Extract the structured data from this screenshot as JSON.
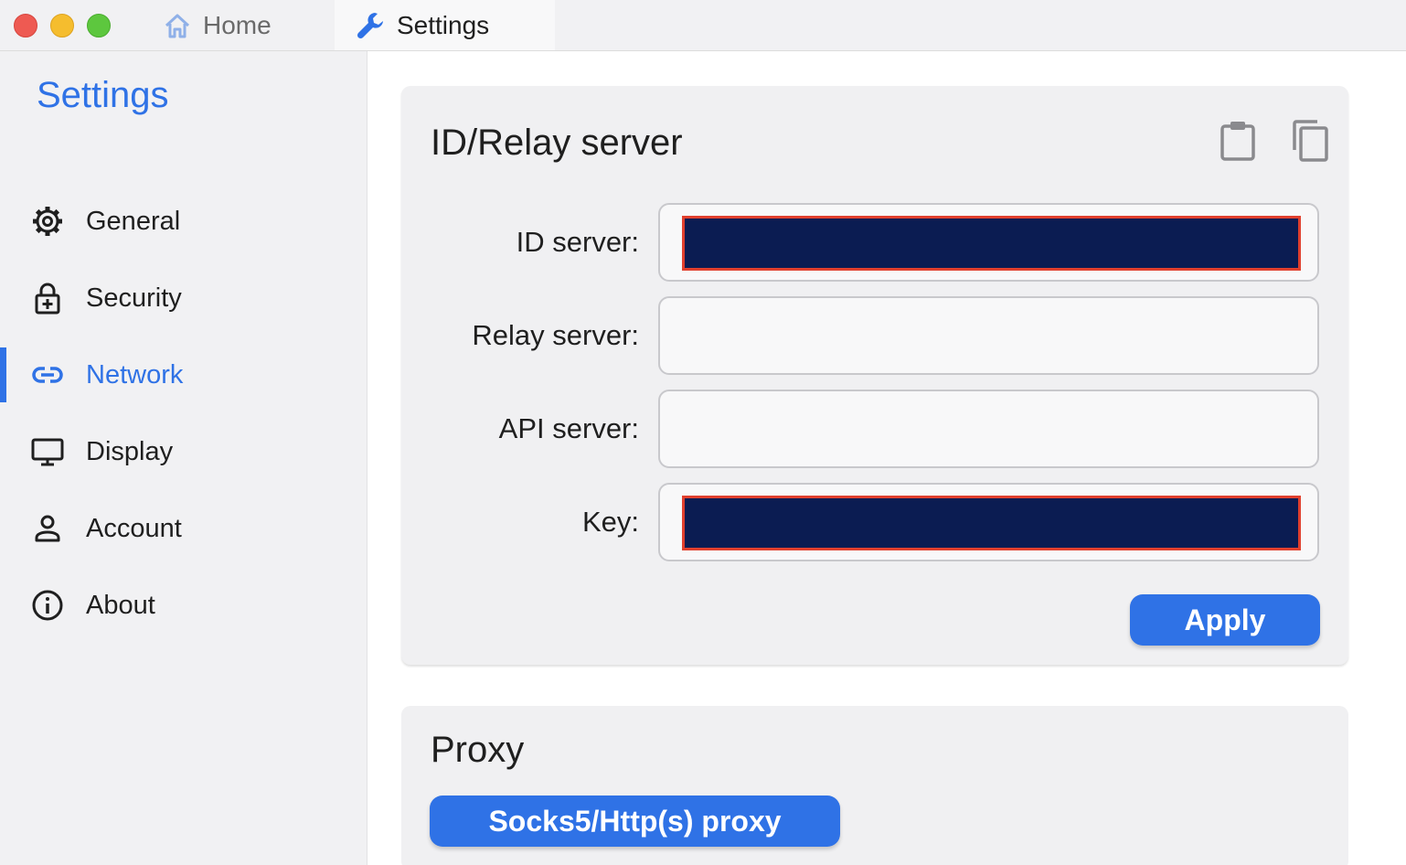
{
  "window": {
    "tabs": [
      {
        "label": "Home",
        "icon": "home-icon"
      },
      {
        "label": "Settings",
        "icon": "wrench-icon"
      }
    ]
  },
  "sidebar": {
    "title": "Settings",
    "items": [
      {
        "label": "General",
        "icon": "gear-icon"
      },
      {
        "label": "Security",
        "icon": "lock-icon"
      },
      {
        "label": "Network",
        "icon": "link-icon",
        "active": true
      },
      {
        "label": "Display",
        "icon": "monitor-icon"
      },
      {
        "label": "Account",
        "icon": "person-icon"
      },
      {
        "label": "About",
        "icon": "info-icon"
      }
    ]
  },
  "relay": {
    "title": "ID/Relay server",
    "actions": {
      "paste": "clipboard-icon",
      "copy": "copy-icon"
    },
    "fields": [
      {
        "label": "ID server:",
        "value": "",
        "redacted": true
      },
      {
        "label": "Relay server:",
        "value": "",
        "redacted": false
      },
      {
        "label": "API server:",
        "value": "",
        "redacted": false
      },
      {
        "label": "Key:",
        "value": "",
        "redacted": true
      }
    ],
    "apply_label": "Apply"
  },
  "proxy": {
    "title": "Proxy",
    "button_label": "Socks5/Http(s) proxy"
  },
  "colors": {
    "accent": "#2f72e6",
    "redaction_fill": "#0b1c52",
    "redaction_border": "#e1402e"
  }
}
